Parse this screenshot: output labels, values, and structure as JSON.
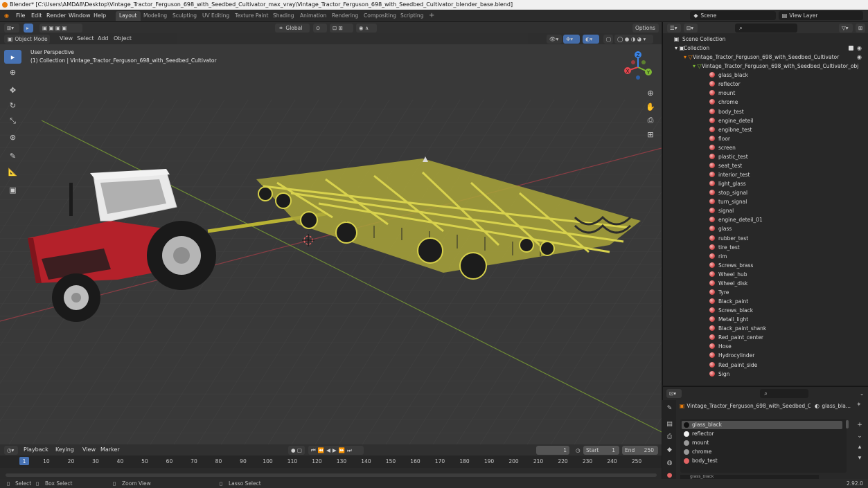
{
  "window": {
    "title": "Blender* [C:\\Users\\AMDA8\\Desktop\\Vintage_Tractor_Ferguson_698_with_Seedbed_Cultivator_max_vray\\Vintage_Tractor_Ferguson_698_with_Seedbed_Cultivator_blender_base.blend]"
  },
  "menu": [
    "File",
    "Edit",
    "Render",
    "Window",
    "Help"
  ],
  "workspaces": [
    "Layout",
    "Modeling",
    "Sculpting",
    "UV Editing",
    "Texture Paint",
    "Shading",
    "Animation",
    "Rendering",
    "Compositing",
    "Scripting"
  ],
  "active_workspace": "Layout",
  "scene": {
    "label": "Scene",
    "view_layer": "View Layer"
  },
  "viewport_header": {
    "orientation": "Global",
    "options": "Options",
    "mode": "Object Mode",
    "menus": [
      "View",
      "Select",
      "Add",
      "Object"
    ]
  },
  "viewport": {
    "perspective": "User Perspective",
    "collection_line": "(1) Collection | Vintage_Tractor_Ferguson_698_with_Seedbed_Cultivator",
    "gizmo": {
      "x": "X",
      "y": "Y",
      "z": "Z"
    },
    "colors": {
      "x_axis": "#e0464d",
      "y_axis": "#7eb834",
      "z_axis": "#3b84e6",
      "implement": "#c8c23a",
      "tractor_red": "#b4212a"
    }
  },
  "tools": [
    "select-box",
    "cursor",
    "move",
    "rotate",
    "scale",
    "transform",
    "annotate",
    "measure",
    "add-cube"
  ],
  "outliner": {
    "scene_collection": "Scene Collection",
    "collection": "Collection",
    "object": "Vintage_Tractor_Ferguson_698_with_Seedbed_Cultivator",
    "mesh": "Vintage_Tractor_Ferguson_698_with_Seedbed_Cultivator_obj",
    "materials": [
      "glass_black",
      "reflector",
      "mount",
      "chrome",
      "body_test",
      "engine_deteil",
      "engibne_test",
      "floor",
      "screen",
      "plastic_test",
      "seat_test",
      "interior_test",
      "light_glass",
      "stop_signal",
      "turn_signal",
      "signal",
      "engine_deteil_01",
      "glass",
      "rubber_test",
      "tire_test",
      "rim",
      "Screws_brass",
      "Wheel_hub",
      "Wheel_disk",
      "Tyre",
      "Black_paint",
      "Screws_black",
      "Metall_light",
      "Black_paint_shank",
      "Red_paint_center",
      "Hose",
      "Hydrocylinder",
      "Red_paint_side",
      "Sign"
    ]
  },
  "properties": {
    "object_name": "Vintage_Tractor_Ferguson_698_with_Seedbed_C...",
    "material_name": "glass_bla...",
    "slots": [
      "glass_black",
      "reflector",
      "mount",
      "chrome",
      "body_test"
    ],
    "selected_slot": "glass_black",
    "bottom_field": "glass_black"
  },
  "timeline": {
    "menus": [
      "Playback",
      "Keying",
      "View",
      "Marker"
    ],
    "current_frame": "1",
    "start_label": "Start",
    "start": "1",
    "end_label": "End",
    "end": "250",
    "ticks": [
      "1",
      "10",
      "20",
      "30",
      "40",
      "50",
      "60",
      "70",
      "80",
      "90",
      "100",
      "110",
      "120",
      "130",
      "140",
      "150",
      "160",
      "170",
      "180",
      "190",
      "200",
      "210",
      "220",
      "230",
      "240",
      "250"
    ]
  },
  "statusbar": {
    "select": "Select",
    "box_select": "Box Select",
    "zoom_view": "Zoom View",
    "lasso_select": "Lasso Select",
    "version": "2.92.0"
  }
}
